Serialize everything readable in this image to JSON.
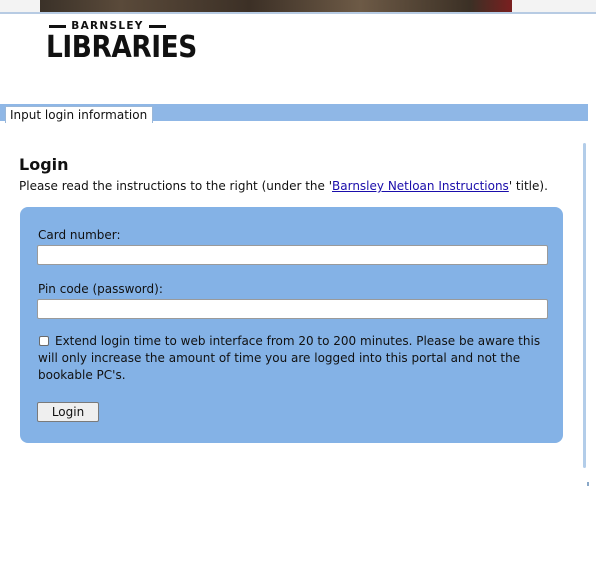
{
  "logo": {
    "top_text": "BARNSLEY",
    "main_text": "LIBRARIES"
  },
  "tabs": [
    {
      "label": "Input login information"
    }
  ],
  "login": {
    "title": "Login",
    "instructions_prefix": "Please read the instructions to the right (under the '",
    "instructions_link": "Barnsley Netloan Instructions",
    "instructions_suffix": "' title).",
    "card_label": "Card number:",
    "card_value": "",
    "pin_label": "Pin code (password):",
    "pin_value": "",
    "extend_text": "Extend login time to web interface from 20 to 200 minutes. Please be aware this will only increase the amount of time you are logged into this portal and not the bookable PC's.",
    "extend_checked": false,
    "button_label": "Login"
  },
  "colors": {
    "panel": "#84b2e6",
    "tab_bar": "#8fb7e6",
    "link": "#1a0dab"
  }
}
